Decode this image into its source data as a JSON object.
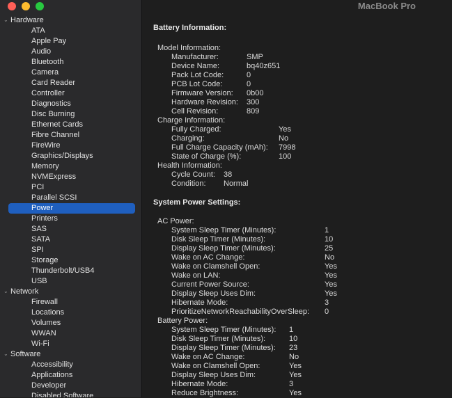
{
  "window": {
    "title": "MacBook Pro"
  },
  "sidebar": {
    "categories": [
      {
        "label": "Hardware",
        "items": [
          "ATA",
          "Apple Pay",
          "Audio",
          "Bluetooth",
          "Camera",
          "Card Reader",
          "Controller",
          "Diagnostics",
          "Disc Burning",
          "Ethernet Cards",
          "Fibre Channel",
          "FireWire",
          "Graphics/Displays",
          "Memory",
          "NVMExpress",
          "PCI",
          "Parallel SCSI",
          "Power",
          "Printers",
          "SAS",
          "SATA",
          "SPI",
          "Storage",
          "Thunderbolt/USB4",
          "USB"
        ]
      },
      {
        "label": "Network",
        "items": [
          "Firewall",
          "Locations",
          "Volumes",
          "WWAN",
          "Wi-Fi"
        ]
      },
      {
        "label": "Software",
        "items": [
          "Accessibility",
          "Applications",
          "Developer",
          "Disabled Software"
        ]
      }
    ],
    "selected": "Power"
  },
  "battery": {
    "title": "Battery Information:",
    "model": {
      "label": "Model Information:",
      "rows": [
        {
          "k": "Manufacturer:",
          "v": "SMP"
        },
        {
          "k": "Device Name:",
          "v": "bq40z651"
        },
        {
          "k": "Pack Lot Code:",
          "v": "0"
        },
        {
          "k": "PCB Lot Code:",
          "v": "0"
        },
        {
          "k": "Firmware Version:",
          "v": "0b00"
        },
        {
          "k": "Hardware Revision:",
          "v": "300"
        },
        {
          "k": "Cell Revision:",
          "v": "809"
        }
      ]
    },
    "charge": {
      "label": "Charge Information:",
      "rows": [
        {
          "k": "Fully Charged:",
          "v": "Yes"
        },
        {
          "k": "Charging:",
          "v": "No"
        },
        {
          "k": "Full Charge Capacity (mAh):",
          "v": "7998"
        },
        {
          "k": "State of Charge (%):",
          "v": "100"
        }
      ]
    },
    "health": {
      "label": "Health Information:",
      "rows": [
        {
          "k": "Cycle Count:",
          "v": "38"
        },
        {
          "k": "Condition:",
          "v": "Normal"
        }
      ]
    }
  },
  "power": {
    "title": "System Power Settings:",
    "ac": {
      "label": "AC Power:",
      "rows": [
        {
          "k": "System Sleep Timer (Minutes):",
          "v": "1"
        },
        {
          "k": "Disk Sleep Timer (Minutes):",
          "v": "10"
        },
        {
          "k": "Display Sleep Timer (Minutes):",
          "v": "25"
        },
        {
          "k": "Wake on AC Change:",
          "v": "No"
        },
        {
          "k": "Wake on Clamshell Open:",
          "v": "Yes"
        },
        {
          "k": "Wake on LAN:",
          "v": "Yes"
        },
        {
          "k": "Current Power Source:",
          "v": "Yes"
        },
        {
          "k": "Display Sleep Uses Dim:",
          "v": "Yes"
        },
        {
          "k": "Hibernate Mode:",
          "v": "3"
        },
        {
          "k": "PrioritizeNetworkReachabilityOverSleep:",
          "v": "0"
        }
      ]
    },
    "battery_power": {
      "label": "Battery Power:",
      "rows": [
        {
          "k": "System Sleep Timer (Minutes):",
          "v": "1"
        },
        {
          "k": "Disk Sleep Timer (Minutes):",
          "v": "10"
        },
        {
          "k": "Display Sleep Timer (Minutes):",
          "v": "23"
        },
        {
          "k": "Wake on AC Change:",
          "v": "No"
        },
        {
          "k": "Wake on Clamshell Open:",
          "v": "Yes"
        },
        {
          "k": "Display Sleep Uses Dim:",
          "v": "Yes"
        },
        {
          "k": "Hibernate Mode:",
          "v": "3"
        },
        {
          "k": "Reduce Brightness:",
          "v": "Yes"
        }
      ]
    }
  }
}
